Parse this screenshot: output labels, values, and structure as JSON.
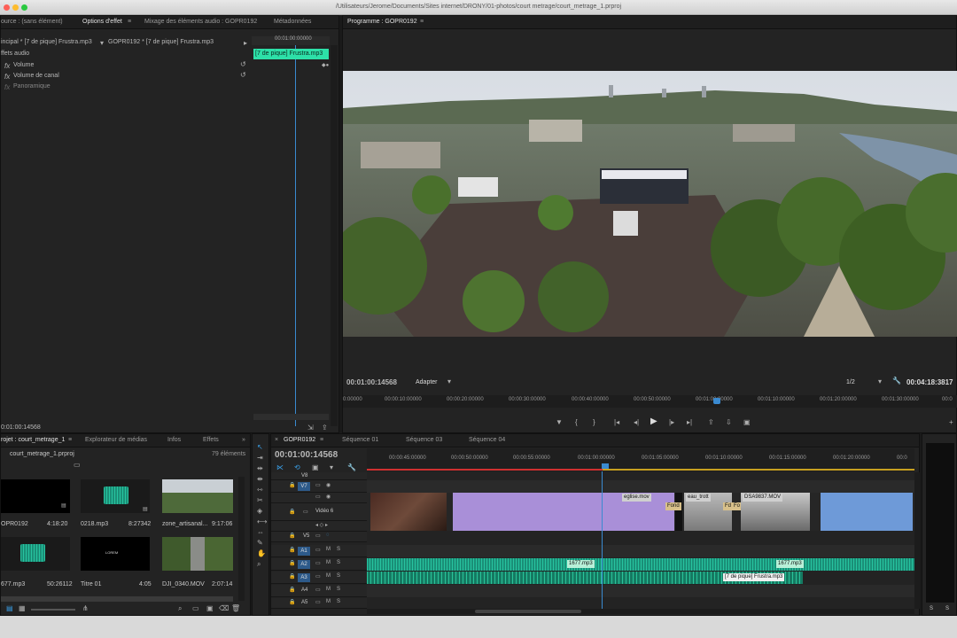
{
  "window": {
    "title": "/Utilisateurs/Jerome/Documents/Sites internet/DRONY/01-photos/court metrage/court_metrage_1.prproj"
  },
  "effects_panel": {
    "tabs": [
      "ource : (sans élément)",
      "Options d'effet",
      "Mixage des éléments audio : GOPR0192",
      "Métadonnées"
    ],
    "master": "incipal * [7 de pique] Frustra.mp3",
    "seq_clip": "GOPR0192 * [7 de pique] Frustra.mp3",
    "ruler_time": "00:01:00:00000",
    "clip_label": "[7 de pique] Frustra.mp3",
    "section": "ffets audio",
    "effects": [
      "Volume",
      "Volume de canal",
      "Panoramique"
    ],
    "timecode": "0:01:00:14568"
  },
  "program": {
    "title": "Programme : GOPR0192",
    "timecode": "00:01:00:14568",
    "fit": "Adapter",
    "quality": "1/2",
    "duration": "00:04:18:3817",
    "ruler": [
      "0:00000",
      "00:00:10:00000",
      "00:00:20:00000",
      "00:00:30:00000",
      "00:00:40:00000",
      "00:00:50:00000",
      "00:01:00:00000",
      "00:01:10:00000",
      "00:01:20:00000",
      "00:01:30:00000",
      "00:0"
    ]
  },
  "project": {
    "tabs": [
      "rojet : court_metrage_1",
      "Explorateur de médias",
      "Infos",
      "Effets"
    ],
    "file": "court_metrage_1.prproj",
    "count": "79 éléments",
    "items": [
      {
        "name": "OPR0192",
        "dur": "4:18:20"
      },
      {
        "name": "0218.mp3",
        "dur": "8:27342"
      },
      {
        "name": "zone_artisanal...",
        "dur": "9:17:06"
      },
      {
        "name": "677.mp3",
        "dur": "50:26112"
      },
      {
        "name": "Titre 01",
        "dur": "4:05"
      },
      {
        "name": "DJI_0340.MOV",
        "dur": "2:07:14"
      }
    ],
    "title_thumb_text": "LOREM"
  },
  "timeline": {
    "tab": "GOPR0192",
    "tabs2": [
      "Séquence 01",
      "Séquence 03",
      "Séquence 04"
    ],
    "timecode": "00:01:00:14568",
    "ruler": [
      "00:00:45:00000",
      "00:00:50:00000",
      "00:00:55:00000",
      "00:01:00:00000",
      "00:01:05:00000",
      "00:01:10:00000",
      "00:01:15:00000",
      "00:01:20:00000",
      "00:0"
    ],
    "tracks": [
      "V8",
      "V7",
      "",
      "V6",
      "Vidéo 6",
      "",
      "V5",
      "A1",
      "A2",
      "A3",
      "A4",
      "A5"
    ],
    "clips": [
      "eglise.mov",
      "eau_trott",
      "DSA9837.MOV",
      "Fond",
      "Fd",
      "Fo"
    ],
    "audio_clips": [
      "1677.mp3",
      "1677.mp3",
      "[7 de pique] Frustra.mp3"
    ]
  },
  "meter": {
    "labels": [
      "S",
      "S"
    ]
  }
}
